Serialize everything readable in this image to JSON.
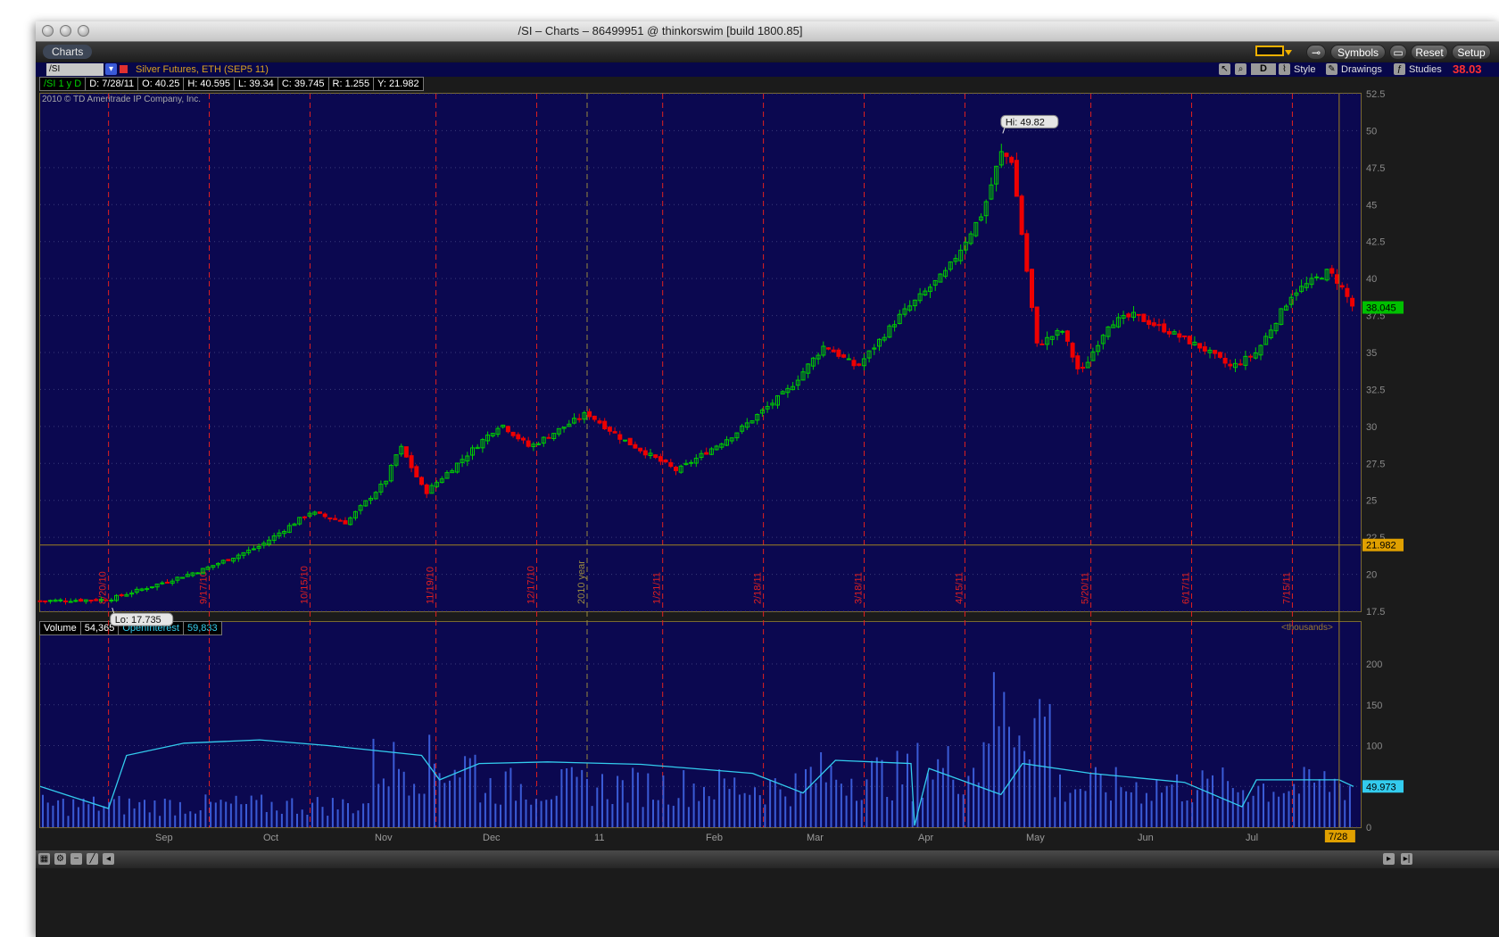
{
  "window": {
    "title": "/SI – Charts – 86499951 @ thinkorswim [build 1800.85]"
  },
  "toolbar": {
    "charts_tab": "Charts",
    "symbols": "Symbols",
    "reset": "Reset",
    "setup": "Setup"
  },
  "symbol_bar": {
    "symbol": "/SI",
    "description": "Silver Futures, ETH (SEP5 11)",
    "period": "D",
    "style": "Style",
    "drawings": "Drawings",
    "studies": "Studies",
    "last_price": "38.03"
  },
  "info_row": {
    "id": "/SI 1 y D",
    "date": "D: 7/28/11",
    "open": "O: 40.25",
    "high": "H: 40.595",
    "low": "L: 39.34",
    "close": "C: 39.745",
    "range": "R: 1.255",
    "y": "Y: 21.982"
  },
  "copyright": "2010 © TD Ameritrade IP Company, Inc.",
  "annotations": {
    "hi": "Hi: 49.82",
    "lo": "Lo: 17.735"
  },
  "volume_header": {
    "volume_label": "Volume",
    "volume_value": "54,365",
    "oi_label": "OpenInterest",
    "oi_value": "59,833",
    "units": "<thousands>"
  },
  "badges": {
    "price": "38.045",
    "crosshair": "21.982",
    "oi": "49.973",
    "date": "7/28"
  },
  "colors": {
    "panel_bg": "#0b0850",
    "up_candle": "#00cc00",
    "down_candle": "#ee0000",
    "divider": "#e02020",
    "volume_bar": "#3a5bd6",
    "open_interest": "#33ccee"
  },
  "chart_data": {
    "type": "candlestick",
    "symbol": "/SI",
    "period": "1 year, daily",
    "price_axis": {
      "min": 17.5,
      "max": 52.5,
      "ticks": [
        "52.5",
        "50",
        "47.5",
        "45",
        "42.5",
        "40",
        "37.5",
        "35",
        "32.5",
        "30",
        "27.5",
        "25",
        "22.5",
        "20",
        "17.5"
      ]
    },
    "volume_axis": {
      "min": 0,
      "max": 200,
      "ticks": [
        "200",
        "150",
        "100",
        "50",
        "0"
      ],
      "unit": "thousands"
    },
    "month_labels": [
      "Sep",
      "Oct",
      "Nov",
      "Dec",
      "11",
      "Feb",
      "Mar",
      "Apr",
      "May",
      "Jun",
      "Jul"
    ],
    "expiration_labels": [
      "8/20/10",
      "9/17/10",
      "10/15/10",
      "11/19/10",
      "12/17/10",
      "2010 year",
      "1/21/11",
      "2/18/11",
      "3/18/11",
      "4/15/11",
      "5/20/11",
      "6/17/11",
      "7/15/11"
    ],
    "close_path": [
      {
        "date": "2010-08-01",
        "close": 18.2
      },
      {
        "date": "2010-08-20",
        "close": 18.3
      },
      {
        "date": "2010-09-01",
        "close": 19.2
      },
      {
        "date": "2010-09-15",
        "close": 20.3
      },
      {
        "date": "2010-10-01",
        "close": 21.9
      },
      {
        "date": "2010-10-15",
        "close": 24.2
      },
      {
        "date": "2010-10-25",
        "close": 23.5
      },
      {
        "date": "2010-11-05",
        "close": 26.3
      },
      {
        "date": "2010-11-09",
        "close": 28.7
      },
      {
        "date": "2010-11-16",
        "close": 25.5
      },
      {
        "date": "2010-11-25",
        "close": 27.5
      },
      {
        "date": "2010-12-07",
        "close": 30.2
      },
      {
        "date": "2010-12-15",
        "close": 28.6
      },
      {
        "date": "2010-12-31",
        "close": 30.9
      },
      {
        "date": "2011-01-10",
        "close": 29.1
      },
      {
        "date": "2011-01-25",
        "close": 27.0
      },
      {
        "date": "2011-02-10",
        "close": 29.5
      },
      {
        "date": "2011-02-25",
        "close": 32.5
      },
      {
        "date": "2011-03-07",
        "close": 35.5
      },
      {
        "date": "2011-03-16",
        "close": 34.0
      },
      {
        "date": "2011-03-28",
        "close": 37.5
      },
      {
        "date": "2011-04-10",
        "close": 40.5
      },
      {
        "date": "2011-04-20",
        "close": 44.5
      },
      {
        "date": "2011-04-25",
        "close": 48.5
      },
      {
        "date": "2011-04-28",
        "close": 48.0
      },
      {
        "date": "2011-05-05",
        "close": 35.5
      },
      {
        "date": "2011-05-12",
        "close": 36.5
      },
      {
        "date": "2011-05-17",
        "close": 33.5
      },
      {
        "date": "2011-05-25",
        "close": 37.0
      },
      {
        "date": "2011-06-01",
        "close": 37.5
      },
      {
        "date": "2011-06-10",
        "close": 36.5
      },
      {
        "date": "2011-06-20",
        "close": 35.3
      },
      {
        "date": "2011-06-28",
        "close": 34.0
      },
      {
        "date": "2011-07-05",
        "close": 35.0
      },
      {
        "date": "2011-07-15",
        "close": 39.0
      },
      {
        "date": "2011-07-25",
        "close": 40.5
      },
      {
        "date": "2011-07-28",
        "close": 39.7
      },
      {
        "date": "2011-08-01",
        "close": 38.0
      }
    ],
    "open_interest_path": [
      {
        "date": "2010-08-01",
        "oi": 50
      },
      {
        "date": "2010-08-20",
        "oi": 23
      },
      {
        "date": "2010-08-25",
        "oi": 88
      },
      {
        "date": "2010-09-10",
        "oi": 103
      },
      {
        "date": "2010-10-01",
        "oi": 107
      },
      {
        "date": "2010-10-20",
        "oi": 100
      },
      {
        "date": "2010-11-15",
        "oi": 88
      },
      {
        "date": "2010-11-20",
        "oi": 58
      },
      {
        "date": "2010-12-01",
        "oi": 78
      },
      {
        "date": "2010-12-20",
        "oi": 80
      },
      {
        "date": "2011-01-15",
        "oi": 77
      },
      {
        "date": "2011-02-15",
        "oi": 66
      },
      {
        "date": "2011-03-01",
        "oi": 42
      },
      {
        "date": "2011-03-10",
        "oi": 82
      },
      {
        "date": "2011-03-31",
        "oi": 78
      },
      {
        "date": "2011-04-01",
        "oi": 2
      },
      {
        "date": "2011-04-05",
        "oi": 72
      },
      {
        "date": "2011-04-25",
        "oi": 40
      },
      {
        "date": "2011-05-01",
        "oi": 78
      },
      {
        "date": "2011-05-20",
        "oi": 66
      },
      {
        "date": "2011-06-15",
        "oi": 55
      },
      {
        "date": "2011-07-01",
        "oi": 25
      },
      {
        "date": "2011-07-05",
        "oi": 58
      },
      {
        "date": "2011-07-28",
        "oi": 58
      },
      {
        "date": "2011-08-01",
        "oi": 50
      }
    ],
    "volume_profile": [
      {
        "from": "2010-08-01",
        "to": "2010-10-31",
        "level": 30
      },
      {
        "from": "2010-11-01",
        "to": "2010-11-30",
        "level": 85
      },
      {
        "from": "2010-12-01",
        "to": "2011-02-28",
        "level": 55
      },
      {
        "from": "2011-03-01",
        "to": "2011-03-31",
        "level": 70
      },
      {
        "from": "2011-04-01",
        "to": "2011-04-20",
        "level": 80
      },
      {
        "from": "2011-04-20",
        "to": "2011-05-10",
        "level": 150
      },
      {
        "from": "2011-05-10",
        "to": "2011-07-20",
        "level": 55
      },
      {
        "from": "2011-07-20",
        "to": "2011-08-01",
        "level": 60
      }
    ]
  }
}
